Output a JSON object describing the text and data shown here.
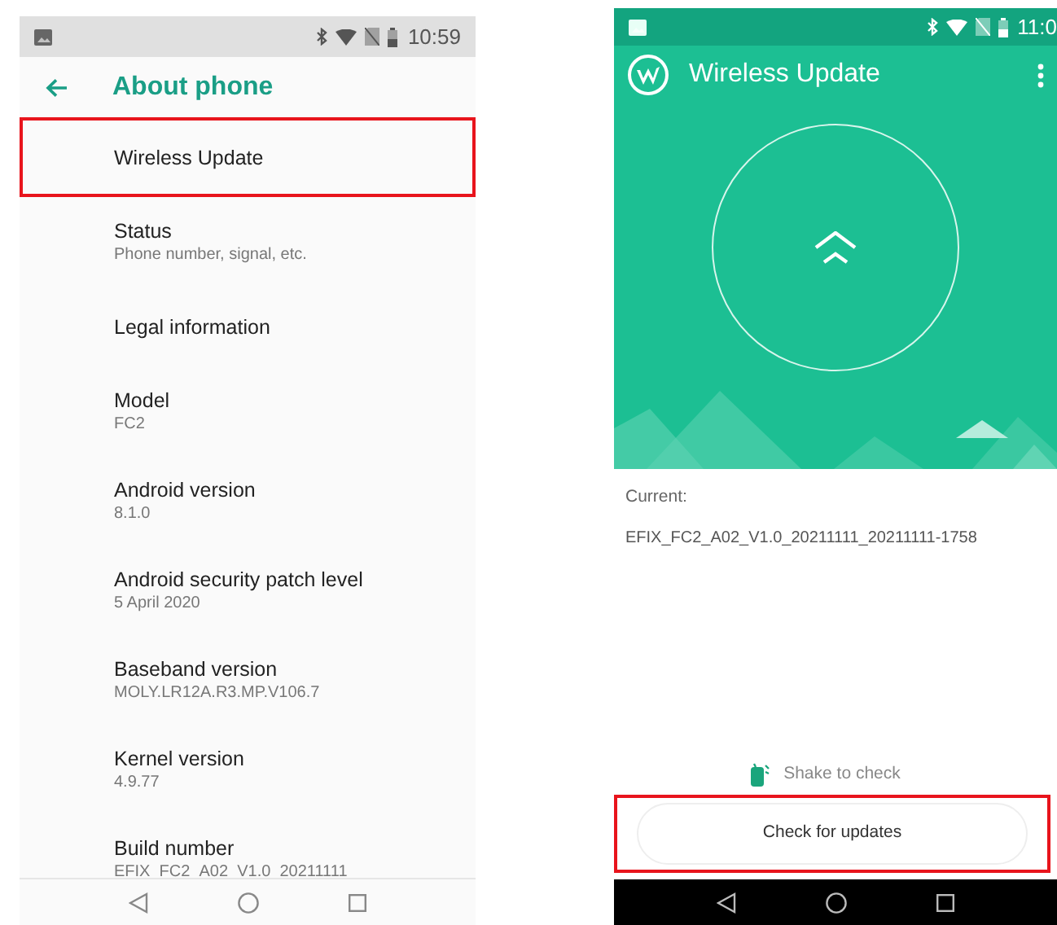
{
  "settings_screen": {
    "status_bar": {
      "time": "10:59"
    },
    "title": "About phone",
    "items": [
      {
        "title": "Wireless Update",
        "highlighted": true
      },
      {
        "title": "Status",
        "subtitle": "Phone number, signal, etc.",
        "highlighted": false
      },
      {
        "title": "Legal information",
        "highlighted": false
      },
      {
        "title": "Model",
        "subtitle": "FC2",
        "highlighted": false
      },
      {
        "title": "Android version",
        "subtitle": "8.1.0",
        "highlighted": false
      },
      {
        "title": "Android security patch level",
        "subtitle": "5 April 2020",
        "highlighted": false
      },
      {
        "title": "Baseband version",
        "subtitle": "MOLY.LR12A.R3.MP.V106.7",
        "highlighted": false
      },
      {
        "title": "Kernel version",
        "subtitle": "4.9.77",
        "highlighted": false
      },
      {
        "title": "Build number",
        "subtitle": "EFIX_FC2_A02_V1.0_20211111",
        "highlighted": false
      }
    ]
  },
  "update_screen": {
    "status_bar": {
      "time": "11:0"
    },
    "title": "Wireless Update",
    "current_label": "Current:",
    "current_version": "EFIX_FC2_A02_V1.0_20211111_20211111-1758",
    "shake_hint": "Shake to check",
    "button": {
      "label": "Check for updates",
      "highlighted": true
    }
  }
}
